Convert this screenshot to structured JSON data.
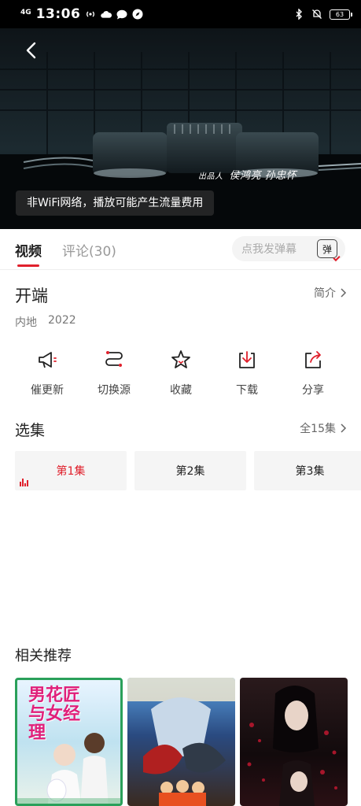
{
  "status_bar": {
    "network": "4G",
    "time": "13:06",
    "battery": "63"
  },
  "video": {
    "credit_small": "出品人",
    "credit_names": "侯鸿亮  孙忠怀",
    "wifi_tip": "非WiFi网络，播放可能产生流量费用"
  },
  "tabs": {
    "video": "视频",
    "comments": "评论(30)",
    "danmu_placeholder": "点我发弹幕",
    "danmu_button": "弹"
  },
  "show": {
    "title": "开端",
    "intro_link": "简介",
    "region": "内地",
    "year": "2022"
  },
  "actions": [
    {
      "label": "催更新",
      "icon": "megaphone-icon"
    },
    {
      "label": "切换源",
      "icon": "switch-source-icon"
    },
    {
      "label": "收藏",
      "icon": "star-icon"
    },
    {
      "label": "下载",
      "icon": "download-icon"
    },
    {
      "label": "分享",
      "icon": "share-icon"
    }
  ],
  "episodes": {
    "title": "选集",
    "all_label": "全15集",
    "items": [
      "第1集",
      "第2集",
      "第3集"
    ],
    "active_index": 0
  },
  "recommendations": {
    "title": "相关推荐",
    "posters": [
      {
        "text": "男花匠与女经理"
      },
      {
        "text": ""
      },
      {
        "text": ""
      }
    ]
  },
  "colors": {
    "accent": "#e0202c",
    "status_bar": "#000000",
    "text_primary": "#222222",
    "text_secondary": "#777777"
  }
}
